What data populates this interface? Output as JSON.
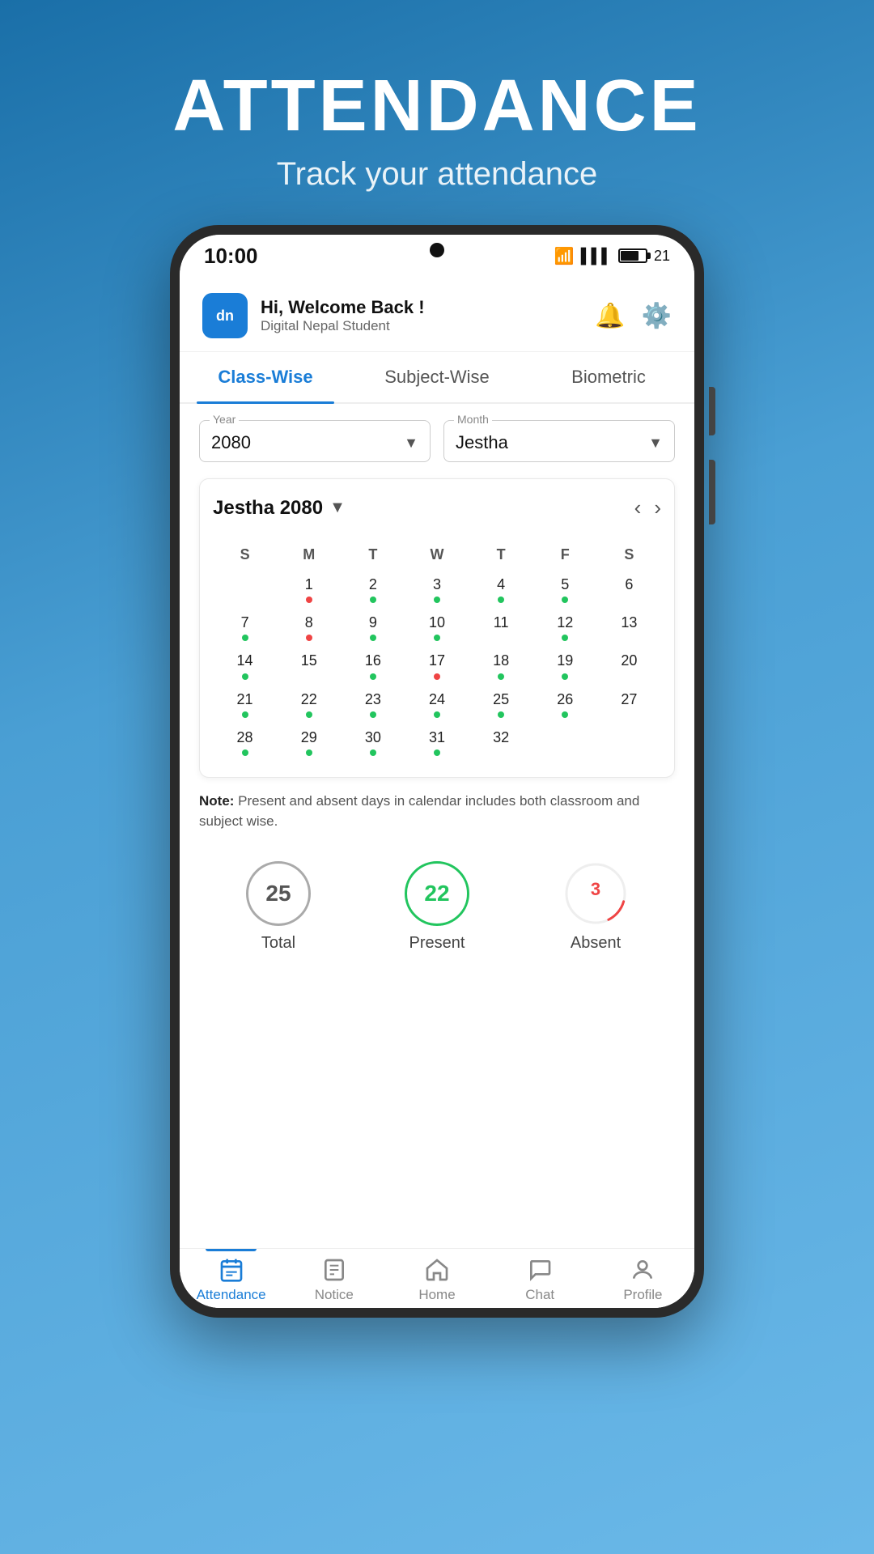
{
  "page": {
    "title": "ATTENDANCE",
    "subtitle": "Track your attendance"
  },
  "statusBar": {
    "time": "10:00",
    "batteryLevel": "21"
  },
  "header": {
    "greeting": "Hi, Welcome Back !",
    "username": "Digital Nepal Student",
    "logoText": "dn"
  },
  "tabs": [
    {
      "id": "class-wise",
      "label": "Class-Wise",
      "active": true
    },
    {
      "id": "subject-wise",
      "label": "Subject-Wise",
      "active": false
    },
    {
      "id": "biometric",
      "label": "Biometric",
      "active": false
    }
  ],
  "filters": {
    "yearLabel": "Year",
    "yearValue": "2080",
    "monthLabel": "Month",
    "monthValue": "Jestha"
  },
  "calendar": {
    "title": "Jestha 2080",
    "dayHeaders": [
      "S",
      "M",
      "T",
      "W",
      "T",
      "F",
      "S"
    ],
    "weeks": [
      [
        {
          "num": "",
          "dot": "none"
        },
        {
          "num": "1",
          "dot": "red"
        },
        {
          "num": "2",
          "dot": "green"
        },
        {
          "num": "3",
          "dot": "green"
        },
        {
          "num": "4",
          "dot": "green"
        },
        {
          "num": "5",
          "dot": "green"
        },
        {
          "num": "6",
          "dot": "none"
        }
      ],
      [
        {
          "num": "7",
          "dot": "green"
        },
        {
          "num": "8",
          "dot": "red"
        },
        {
          "num": "9",
          "dot": "green"
        },
        {
          "num": "10",
          "dot": "green"
        },
        {
          "num": "11",
          "dot": "none"
        },
        {
          "num": "12",
          "dot": "green"
        },
        {
          "num": "13",
          "dot": "none"
        }
      ],
      [
        {
          "num": "14",
          "dot": "green"
        },
        {
          "num": "15",
          "dot": "none"
        },
        {
          "num": "16",
          "dot": "green"
        },
        {
          "num": "17",
          "dot": "red"
        },
        {
          "num": "18",
          "dot": "green"
        },
        {
          "num": "19",
          "dot": "green"
        },
        {
          "num": "20",
          "dot": "none"
        }
      ],
      [
        {
          "num": "21",
          "dot": "green"
        },
        {
          "num": "22",
          "dot": "green"
        },
        {
          "num": "23",
          "dot": "green"
        },
        {
          "num": "24",
          "dot": "green"
        },
        {
          "num": "25",
          "dot": "green"
        },
        {
          "num": "26",
          "dot": "green"
        },
        {
          "num": "27",
          "dot": "none"
        }
      ],
      [
        {
          "num": "28",
          "dot": "green"
        },
        {
          "num": "29",
          "dot": "green"
        },
        {
          "num": "30",
          "dot": "green"
        },
        {
          "num": "31",
          "dot": "green"
        },
        {
          "num": "32",
          "dot": "none"
        },
        {
          "num": "",
          "dot": "none"
        },
        {
          "num": "",
          "dot": "none"
        }
      ]
    ]
  },
  "note": {
    "prefix": "Note:",
    "text": " Present and absent days in calendar includes both classroom and subject wise."
  },
  "stats": {
    "total": {
      "value": "25",
      "label": "Total"
    },
    "present": {
      "value": "22",
      "label": "Present"
    },
    "absent": {
      "value": "3",
      "label": "Absent"
    }
  },
  "bottomNav": [
    {
      "id": "attendance",
      "label": "Attendance",
      "icon": "📅",
      "active": true
    },
    {
      "id": "notice",
      "label": "Notice",
      "icon": "📄",
      "active": false
    },
    {
      "id": "home",
      "label": "Home",
      "icon": "🏠",
      "active": false
    },
    {
      "id": "chat",
      "label": "Chat",
      "icon": "💬",
      "active": false
    },
    {
      "id": "profile",
      "label": "Profile",
      "icon": "👤",
      "active": false
    }
  ]
}
